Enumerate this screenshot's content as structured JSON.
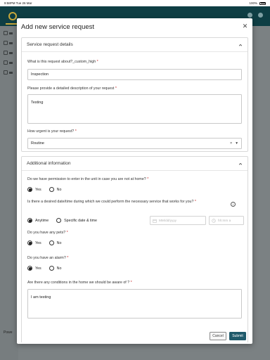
{
  "status_bar": {
    "time": "9:58PM  Tue 26 Mar",
    "battery": "100%"
  },
  "background": {
    "powered_label": "Powe"
  },
  "modal": {
    "title": "Add new service request",
    "sections": {
      "details": {
        "title": "Service request details",
        "about_label": "What is this request about?_custom_high",
        "about_value": "Inspection",
        "description_label": "Please provide a detailed description of your request",
        "description_value": "Testing",
        "urgency_label": "How urgent is your request?",
        "urgency_value": "Routine",
        "urgency_clear": "×",
        "urgency_caret": "▾"
      },
      "additional": {
        "title": "Additional information",
        "permission_label": "Do we have permission to enter in the unit in case you are not at home?",
        "datetime_label": "Is there a desired date/time during which we could perform the necessary service that works for you?",
        "anytime_label": "Anytime",
        "specific_label": "Specific date & time",
        "date_placeholder": "MM/dd/yyyy",
        "time_placeholder": "hh:mm a",
        "pets_label": "Do you have any pets?",
        "alarm_label": "Do you have an alarm?",
        "conditions_label": "Are there any conditions in the home we should be aware of ?",
        "conditions_value": "I am testing"
      }
    },
    "yes": "Yes",
    "no": "No",
    "required_mark": "*",
    "info_glyph": "i",
    "cancel_label": "Cancel",
    "submit_label": "Submit"
  }
}
